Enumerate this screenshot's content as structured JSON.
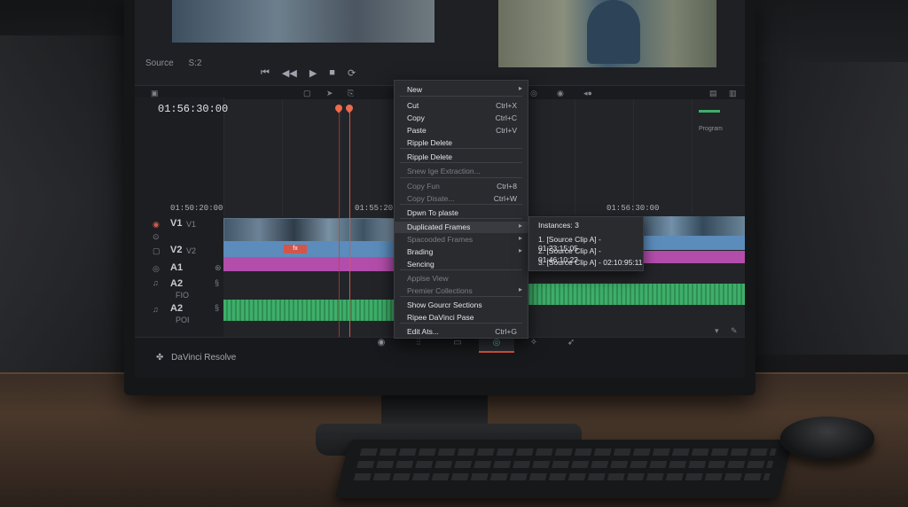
{
  "app": {
    "name": "DaVinci Resolve",
    "source_label": "Source",
    "source_value": "S:2",
    "timecode_main": "01:56:30:00",
    "timecode_track": "01:50:20:00",
    "timecode_mid": "01:55:20:00",
    "timecode_right": "01:56:30:00",
    "program_label": "Program"
  },
  "tracks": [
    {
      "id": "V1",
      "sub": "V1"
    },
    {
      "id": "V2",
      "sub": "V2"
    },
    {
      "id": "A1",
      "sub": ""
    },
    {
      "id": "A2",
      "sub": "FIO"
    },
    {
      "id": "A2",
      "sub": "POI"
    }
  ],
  "context_menu": {
    "items": [
      {
        "label": "New",
        "shortcut": "",
        "submenu": true,
        "disabled": false
      },
      {
        "label": "Cut",
        "shortcut": "Ctrl+X",
        "submenu": false,
        "disabled": false
      },
      {
        "label": "Copy",
        "shortcut": "Ctrl+C",
        "submenu": false,
        "disabled": false
      },
      {
        "label": "Paste",
        "shortcut": "Ctrl+V",
        "submenu": false,
        "disabled": false
      },
      {
        "label": "Ripple Delete",
        "shortcut": "",
        "submenu": false,
        "disabled": false
      },
      {
        "label": "Ripple Delete",
        "shortcut": "",
        "submenu": false,
        "disabled": false
      },
      {
        "label": "Snew Ige Extraction...",
        "shortcut": "",
        "submenu": false,
        "disabled": true
      },
      {
        "label": "Copy Fun",
        "shortcut": "Ctrl+8",
        "submenu": false,
        "disabled": true
      },
      {
        "label": "Copy Disate...",
        "shortcut": "Ctrl+W",
        "submenu": false,
        "disabled": true
      },
      {
        "label": "Dpwn To plaste",
        "shortcut": "",
        "submenu": false,
        "disabled": false
      },
      {
        "label": "Duplicated Frames",
        "shortcut": "",
        "submenu": true,
        "disabled": false
      },
      {
        "label": "Spacooded Frames",
        "shortcut": "",
        "submenu": true,
        "disabled": true
      },
      {
        "label": "Brading",
        "shortcut": "",
        "submenu": true,
        "disabled": false
      },
      {
        "label": "Sencing",
        "shortcut": "",
        "submenu": false,
        "disabled": false
      },
      {
        "label": "Applse View",
        "shortcut": "",
        "submenu": false,
        "disabled": true
      },
      {
        "label": "Premier Collections",
        "shortcut": "",
        "submenu": true,
        "disabled": true
      },
      {
        "label": "Show Gourcr Sections",
        "shortcut": "",
        "submenu": false,
        "disabled": false
      },
      {
        "label": "Ripee DaVinci Pase",
        "shortcut": "",
        "submenu": false,
        "disabled": false
      },
      {
        "label": "Edit Ats...",
        "shortcut": "Ctrl+G",
        "submenu": false,
        "disabled": false
      }
    ]
  },
  "submenu": {
    "title": "Instances: 3",
    "items": [
      "1. [Source Clip A] - 01:23:15:05",
      "2. [Source Clip A] - 01:46:10:22",
      "3. [Source Clip A] - 02:10:95:11"
    ]
  },
  "page_tabs": [
    "Media",
    "Cut",
    "Edit",
    "Color",
    "Fusion",
    "Deliver"
  ],
  "active_tab": "Color"
}
